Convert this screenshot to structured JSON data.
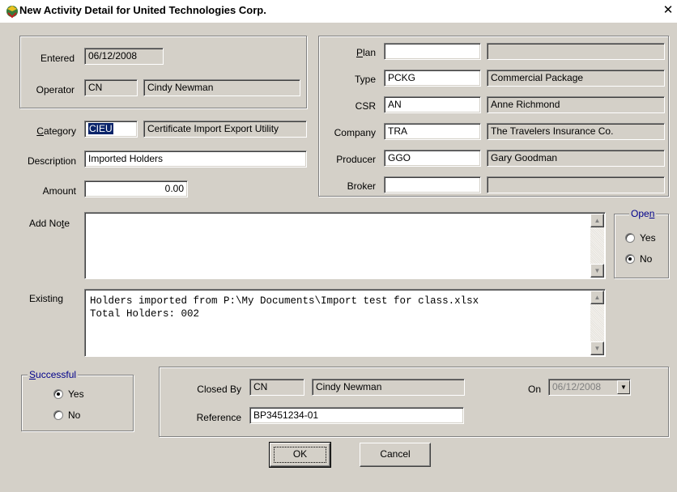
{
  "window": {
    "title": "New Activity Detail for United Technologies Corp.",
    "close_label": "✕"
  },
  "header_left": {
    "entered_label": "Entered",
    "entered_value": "06/12/2008",
    "operator_label": "Operator",
    "operator_code": "CN",
    "operator_name": "Cindy Newman"
  },
  "category": {
    "label_prefix": "",
    "label_accel": "C",
    "label_rest": "ategory",
    "code": "CIEU",
    "name": "Certificate Import Export Utility"
  },
  "description": {
    "label": "Description",
    "value": "Imported Holders"
  },
  "amount": {
    "label": "Amount",
    "value": "0.00"
  },
  "right_panel": {
    "plan": {
      "label_accel": "P",
      "label_rest": "lan",
      "code": "",
      "name": ""
    },
    "type": {
      "label": "Type",
      "code": "PCKG",
      "name": "Commercial Package"
    },
    "csr": {
      "label": "CSR",
      "code": "AN",
      "name": "Anne Richmond"
    },
    "company": {
      "label": "Company",
      "code": "TRA",
      "name": "The Travelers Insurance Co."
    },
    "producer": {
      "label": "Producer",
      "code": "GGO",
      "name": "Gary Goodman"
    },
    "broker": {
      "label": "Broker",
      "code": "",
      "name": ""
    }
  },
  "add_note": {
    "label_prefix": "Add No",
    "label_accel": "t",
    "label_rest": "e",
    "value": ""
  },
  "open_group": {
    "legend_prefix": "Ope",
    "legend_accel": "n",
    "options": [
      {
        "label": "Yes",
        "selected": false
      },
      {
        "label": "No",
        "selected": true
      }
    ]
  },
  "existing": {
    "label": "Existing",
    "lines": [
      "Holders imported from P:\\My Documents\\Import test for class.xlsx",
      "Total Holders: 002"
    ]
  },
  "successful_group": {
    "legend_accel": "S",
    "legend_rest": "uccessful",
    "options": [
      {
        "label": "Yes",
        "selected": true
      },
      {
        "label": "No",
        "selected": false
      }
    ]
  },
  "closing": {
    "closed_by_label": "Closed By",
    "closed_by_code": "CN",
    "closed_by_name": "Cindy Newman",
    "on_label": "On",
    "on_value": "06/12/2008",
    "reference_label": "Reference",
    "reference_value": "BP3451234-01"
  },
  "buttons": {
    "ok": "OK",
    "cancel": "Cancel"
  },
  "colors": {
    "selection": "#0a246a",
    "face": "#d4d0c8",
    "accent_text": "#00008b"
  }
}
